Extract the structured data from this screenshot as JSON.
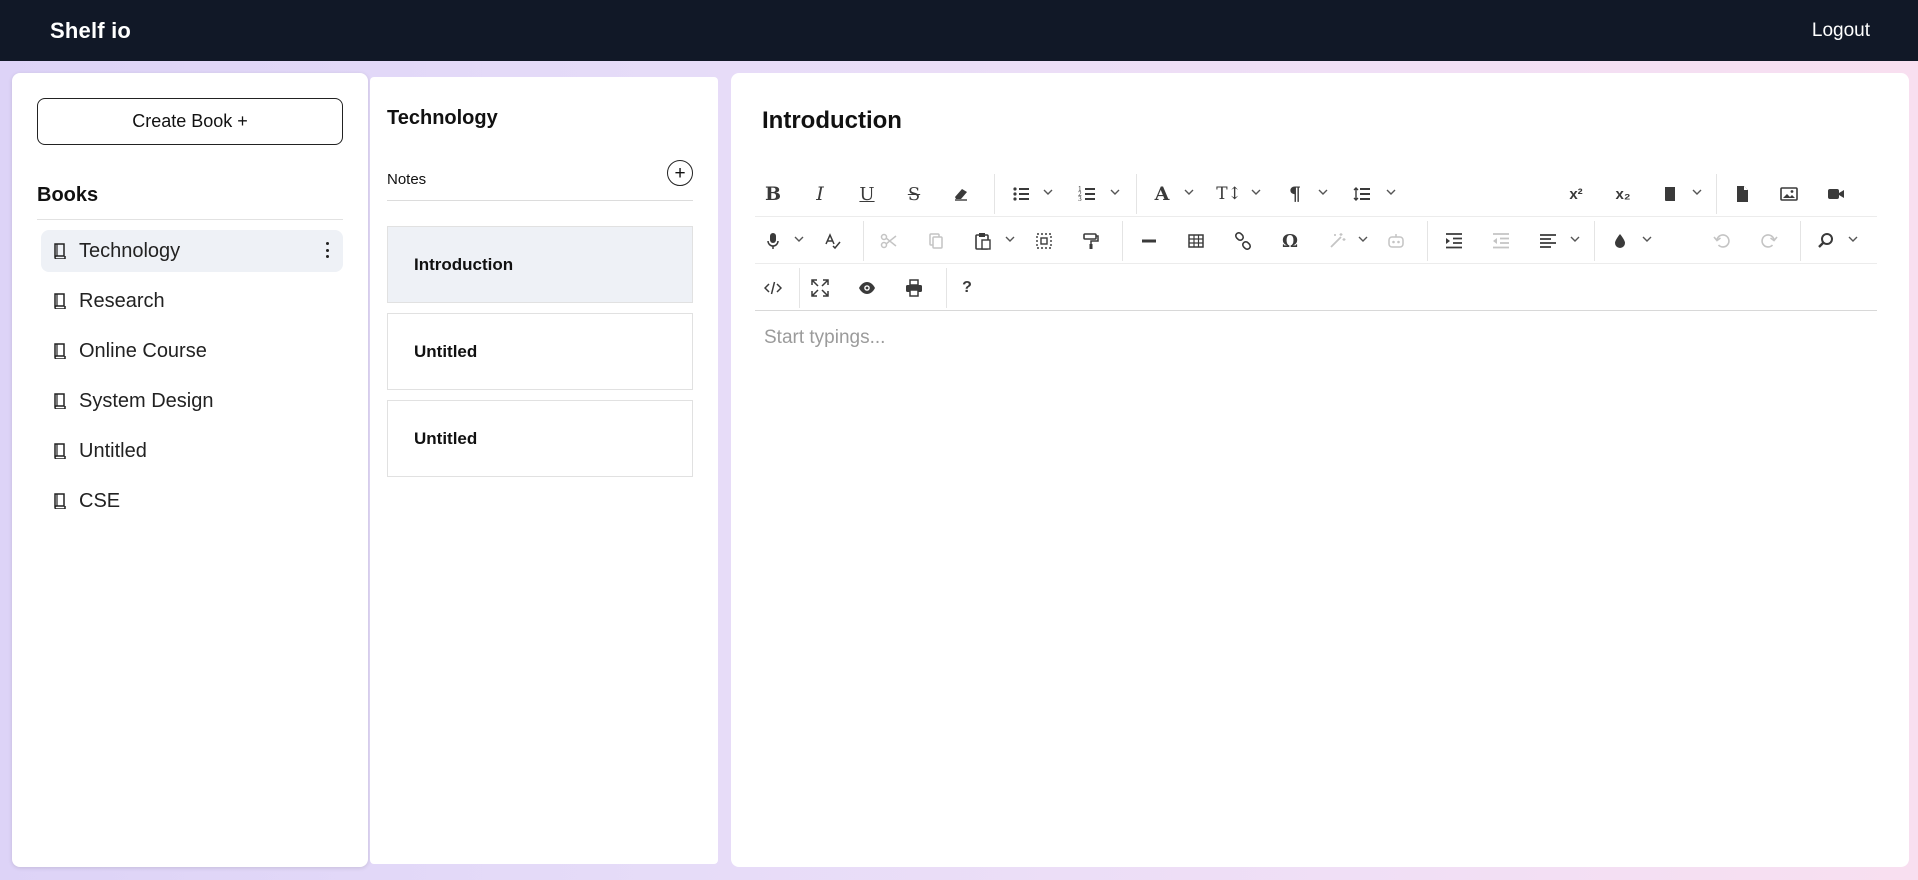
{
  "app": {
    "brand": "Shelf io",
    "logout_label": "Logout"
  },
  "sidebar": {
    "create_label": "Create Book +",
    "heading": "Books",
    "items": [
      {
        "label": "Technology",
        "active": true
      },
      {
        "label": "Research"
      },
      {
        "label": "Online Course"
      },
      {
        "label": "System Design"
      },
      {
        "label": "Untitled"
      },
      {
        "label": "CSE"
      }
    ]
  },
  "notes": {
    "book_title": "Technology",
    "label": "Notes",
    "add_icon": "plus-circle-icon",
    "items": [
      {
        "title": "Introduction",
        "active": true
      },
      {
        "title": "Untitled"
      },
      {
        "title": "Untitled"
      }
    ]
  },
  "editor": {
    "title": "Introduction",
    "placeholder": "Start typings...",
    "toolbar_rows": [
      [
        "bold",
        "italic",
        "underline",
        "strikethrough",
        "eraser",
        "bullet-list",
        "numbered-list",
        "font-color",
        "font-size",
        "paragraph",
        "line-height",
        "superscript",
        "subscript",
        "file",
        "document",
        "image",
        "video"
      ],
      [
        "microphone",
        "spellcheck",
        "cut",
        "copy",
        "paste",
        "select-all",
        "copy-format",
        "horizontal-rule",
        "table",
        "link",
        "special-char",
        "ai-assistant",
        "ai-robot",
        "indent",
        "outdent",
        "align-left",
        "brush",
        "undo",
        "redo",
        "find"
      ],
      [
        "source-code",
        "fullscreen",
        "preview",
        "print",
        "help"
      ]
    ]
  }
}
